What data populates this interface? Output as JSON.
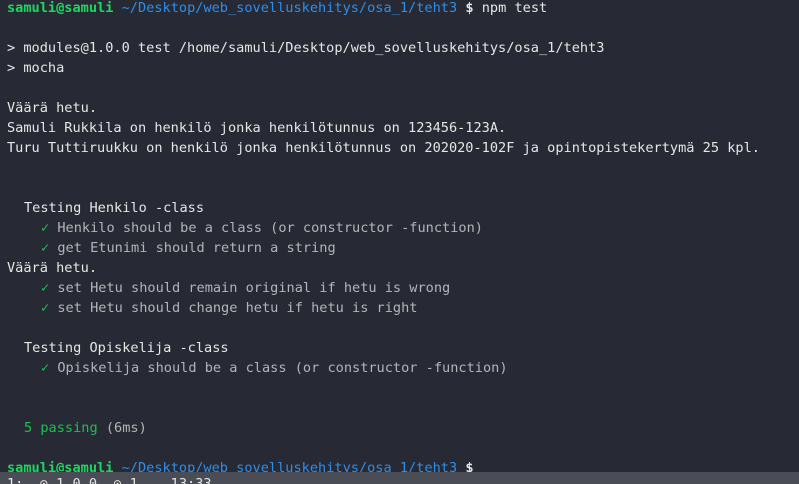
{
  "prompt": {
    "user_host": "samuli@samuli",
    "path": "~/Desktop/web_sovelluskehitys/osa_1/teht3",
    "symbol": "$"
  },
  "command": "npm test",
  "npm_output": [
    "> modules@1.0.0 test /home/samuli/Desktop/web_sovelluskehitys/osa_1/teht3",
    "> mocha"
  ],
  "program_output": [
    "Väärä hetu.",
    "Samuli Rukkila on henkilö jonka henkilötunnus on 123456-123A.",
    "Turu Tuttiruukku on henkilö jonka henkilötunnus on 202020-102F ja opintopistekertymä 25 kpl."
  ],
  "check_symbol": "✓",
  "suite_henkilo": {
    "title": "Testing Henkilo -class",
    "tests_before": [
      "Henkilo should be a class (or constructor -function)",
      "get Etunimi should return a string"
    ],
    "interleaved_output": "Väärä hetu.",
    "tests_after": [
      "set Hetu should remain original if hetu is wrong",
      "set Hetu should change hetu if hetu is right"
    ]
  },
  "suite_opiskelija": {
    "title": "Testing Opiskelija -class",
    "tests": [
      "Opiskelija should be a class (or constructor -function)"
    ]
  },
  "summary": {
    "passing": "5 passing",
    "duration": "(6ms)"
  },
  "status_bar": {
    "text": "1:  ⊙ 1.0.0  ⊙ 1.   13:33"
  },
  "colors": {
    "background": "#272a34",
    "prompt_user": "#1ed760",
    "prompt_path": "#2f8ee8",
    "pass": "#1fc04f",
    "text": "#e6e6e6",
    "dim_text": "#b4b4b8"
  }
}
